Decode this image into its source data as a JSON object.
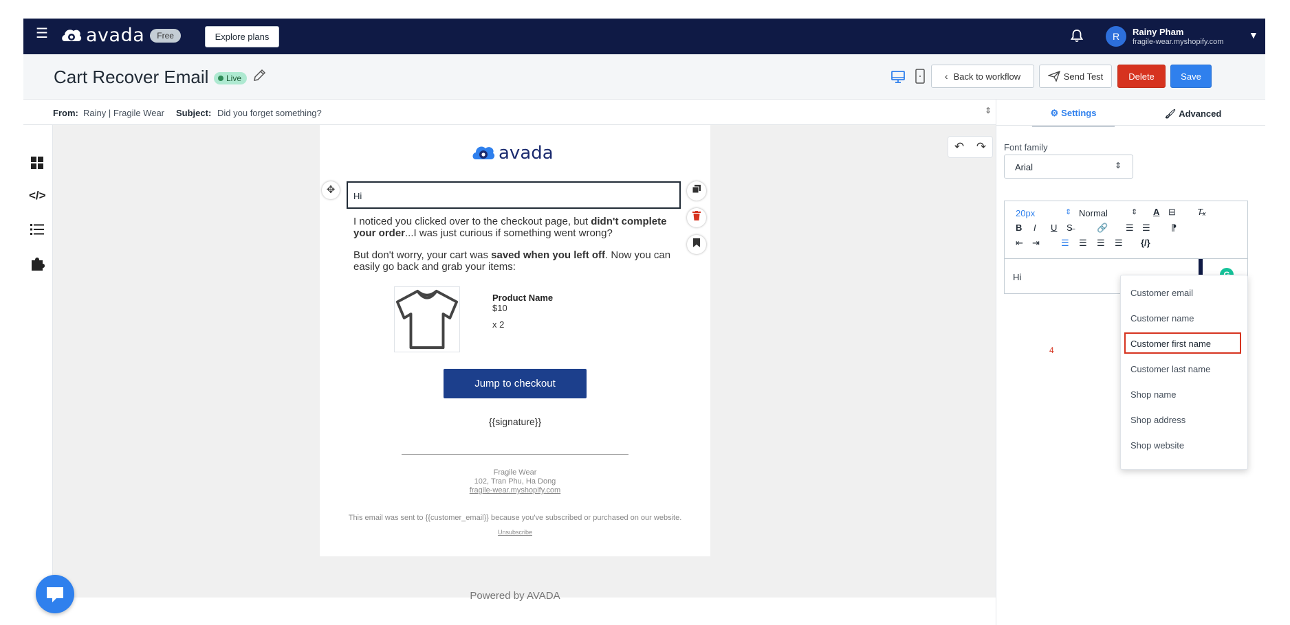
{
  "topnav": {
    "brand": "avada",
    "plan_badge": "Free",
    "explore_label": "Explore plans",
    "user": {
      "initial": "R",
      "name": "Rainy Pham",
      "shop": "fragile-wear.myshopify.com"
    }
  },
  "header": {
    "title": "Cart Recover Email",
    "status": "Live",
    "back_label": "Back to workflow",
    "send_test_label": "Send Test",
    "delete_label": "Delete",
    "save_label": "Save"
  },
  "meta": {
    "from_label": "From:",
    "from_value": "Rainy | Fragile Wear",
    "subject_label": "Subject:",
    "subject_value": "Did you forget something?"
  },
  "email": {
    "brand": "avada",
    "greeting": "Hi",
    "para1_a": "I noticed you clicked over to the checkout page, but ",
    "para1_b": "didn't complete your order",
    "para1_c": "...I was just curious if something went wrong?",
    "para2_a": "But don't worry, your cart was ",
    "para2_b": "saved when you left off",
    "para2_c": ". Now you can easily go back and grab your items:",
    "product": {
      "name": "Product Name",
      "price": "$10",
      "qty": "x 2"
    },
    "cta": "Jump to checkout",
    "signature": "{{signature}}",
    "footer_shop": "Fragile Wear",
    "footer_address": "102, Tran Phu, Ha Dong",
    "footer_link": "fragile-wear.myshopify.com",
    "footer_note": "This email was sent to {{customer_email}} because you've subscribed or purchased on our website.",
    "unsubscribe": "Unsubscribe"
  },
  "powered_by": "Powered by AVADA",
  "panel": {
    "tab_settings": "Settings",
    "tab_advanced": "Advanced",
    "font_family_label": "Font family",
    "font_family_value": "Arial",
    "font_size": "20px",
    "block_type": "Normal",
    "variable_token": "{/}",
    "editor_text": "Hi",
    "step_number": "4"
  },
  "dropdown": {
    "items": [
      "Customer email",
      "Customer name",
      "Customer first name",
      "Customer last name",
      "Shop name",
      "Shop address",
      "Shop website"
    ],
    "highlighted_index": 2
  },
  "colors": {
    "nav_bg": "#0f1a45",
    "primary": "#2f80ed",
    "danger": "#d6331f",
    "cta_bg": "#1c3f8c",
    "live_bg": "#aee9d1"
  }
}
